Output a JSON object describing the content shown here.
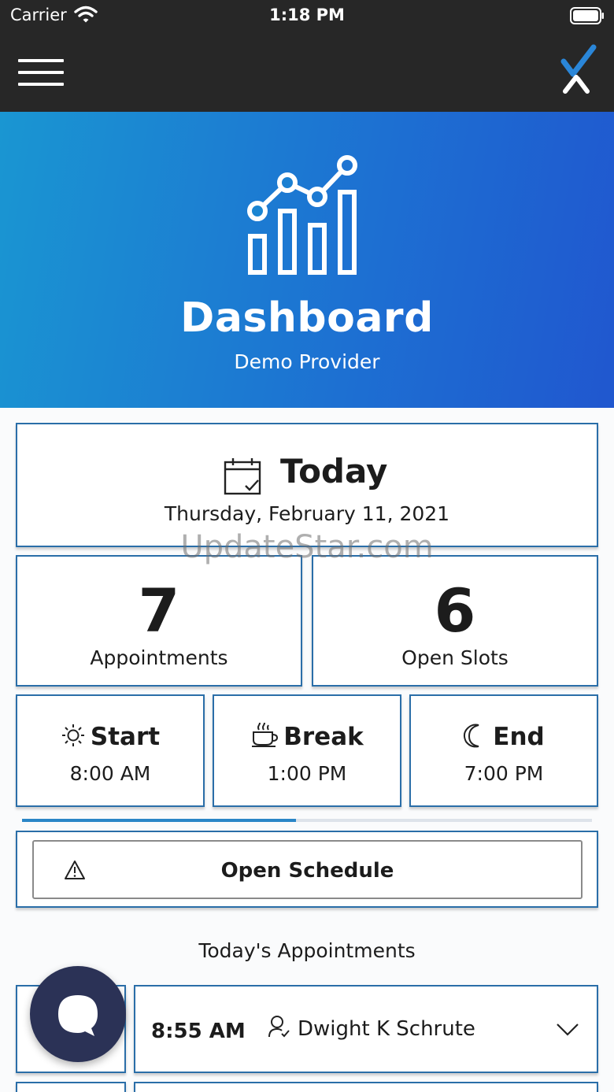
{
  "status_bar": {
    "carrier": "Carrier",
    "time": "1:18 PM"
  },
  "header": {
    "menu_icon": "hamburger-icon",
    "logo_icon": "x-check-logo"
  },
  "hero": {
    "icon": "chart-icon",
    "title": "Dashboard",
    "subtitle": "Demo Provider"
  },
  "today": {
    "icon": "calendar-check-icon",
    "title": "Today",
    "date": "Thursday, February 11, 2021"
  },
  "watermark": "UpdateStar.com",
  "stats": {
    "appointments": {
      "value": "7",
      "label": "Appointments"
    },
    "open_slots": {
      "value": "6",
      "label": "Open Slots"
    }
  },
  "times": {
    "start": {
      "icon": "sun-icon",
      "label": "Start",
      "value": "8:00 AM"
    },
    "break": {
      "icon": "coffee-cup-icon",
      "label": "Break",
      "value": "1:00 PM"
    },
    "end": {
      "icon": "moon-icon",
      "label": "End",
      "value": "7:00 PM"
    }
  },
  "day_progress": 0.48,
  "schedule": {
    "icon": "warning-icon",
    "label": "Open Schedule"
  },
  "appointments_section": {
    "title": "Today's Appointments",
    "items": [
      {
        "time": "8:55 AM",
        "patient": "Dwight K Schrute",
        "icon": "person-icon"
      }
    ]
  },
  "chat_fab": {
    "icon": "chat-bubble-icon"
  },
  "colors": {
    "header_bg": "#272727",
    "hero_gradient_start": "#1a96d2",
    "hero_gradient_end": "#2057cf",
    "card_border": "#2a6ea8",
    "progress": "#2a86c7",
    "fab_bg": "#2b3256"
  }
}
